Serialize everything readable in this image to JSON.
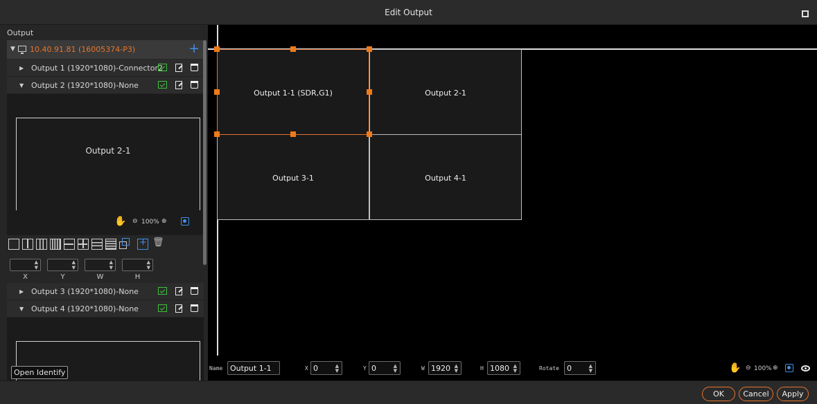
{
  "window": {
    "title": "Edit Output"
  },
  "left": {
    "panel_label": "Output",
    "device": {
      "label": "10.40.91.81  (16005374-P3)"
    },
    "outputs": [
      {
        "label": "Output 1 (1920*1080)-Connector2",
        "expanded": false
      },
      {
        "label": "Output 2 (1920*1080)-None",
        "expanded": true
      },
      {
        "label": "Output 3 (1920*1080)-None",
        "expanded": false
      },
      {
        "label": "Output 4 (1920*1080)-None",
        "expanded": true
      }
    ],
    "preview": {
      "label": "Output 2-1",
      "zoom": "100%"
    },
    "spin_labels": [
      "X",
      "Y",
      "W",
      "H"
    ],
    "identify_label": "Open Identify"
  },
  "canvas": {
    "cells": [
      {
        "label": "Output 1-1 (SDR,G1)"
      },
      {
        "label": "Output 2-1"
      },
      {
        "label": "Output 3-1"
      },
      {
        "label": "Output 4-1"
      }
    ]
  },
  "props": {
    "name_label": "Name",
    "name_value": "Output 1-1",
    "x_label": "X",
    "x_value": "0",
    "y_label": "Y",
    "y_value": "0",
    "w_label": "W",
    "w_value": "1920",
    "h_label": "H",
    "h_value": "1080",
    "rotate_label": "Rotate",
    "rotate_value": "0",
    "zoom": "100%"
  },
  "buttons": {
    "ok": "OK",
    "cancel": "Cancel",
    "apply": "Apply"
  },
  "colors": {
    "accent": "#e8752c",
    "blue": "#3e8fe8",
    "green": "#3fc43f"
  }
}
